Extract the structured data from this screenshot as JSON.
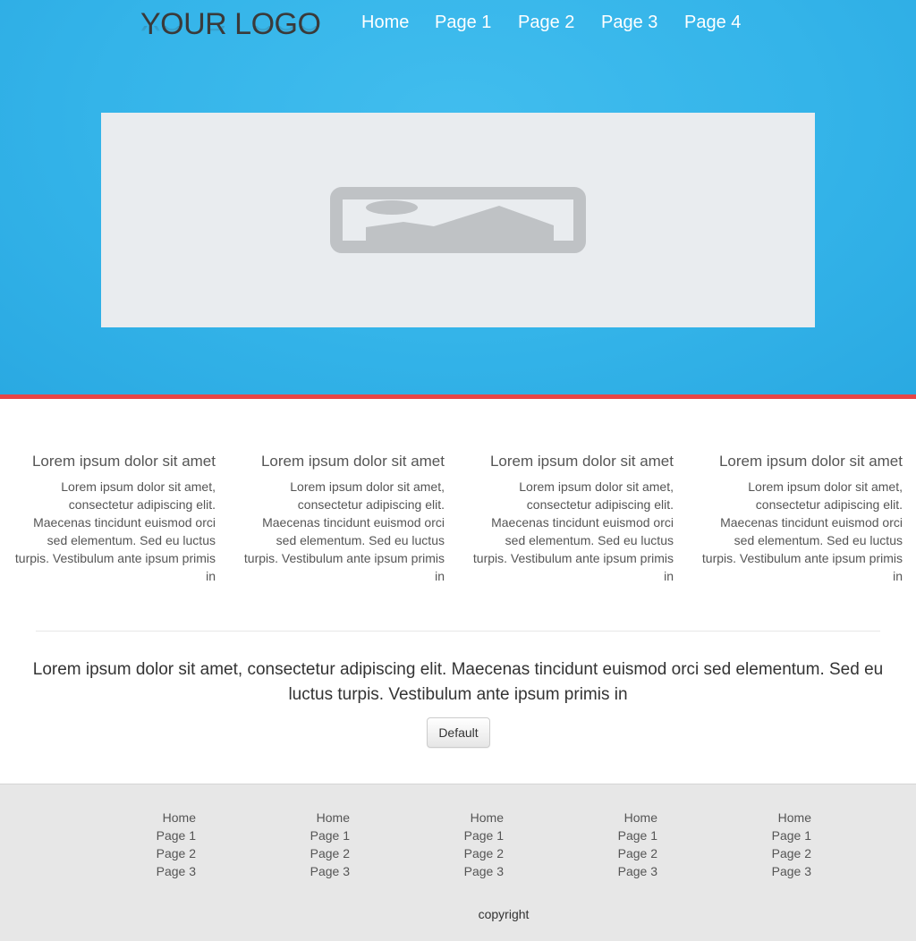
{
  "header": {
    "logo_text": "YOUR LOGO",
    "nav": [
      "Home",
      "Page 1",
      "Page 2",
      "Page 3",
      "Page 4"
    ]
  },
  "hero": {
    "image_icon": "image-placeholder-icon"
  },
  "features": [
    {
      "title": "Lorem ipsum dolor sit amet",
      "text": "Lorem ipsum dolor sit amet, consectetur adipiscing elit. Maecenas tincidunt euismod orci sed elementum. Sed eu luctus turpis. Vestibulum ante ipsum primis in"
    },
    {
      "title": "Lorem ipsum dolor sit amet",
      "text": "Lorem ipsum dolor sit amet, consectetur adipiscing elit. Maecenas tincidunt euismod orci sed elementum. Sed eu luctus turpis. Vestibulum ante ipsum primis in"
    },
    {
      "title": "Lorem ipsum dolor sit amet",
      "text": "Lorem ipsum dolor sit amet, consectetur adipiscing elit. Maecenas tincidunt euismod orci sed elementum. Sed eu luctus turpis. Vestibulum ante ipsum primis in"
    },
    {
      "title": "Lorem ipsum dolor sit amet",
      "text": "Lorem ipsum dolor sit amet, consectetur adipiscing elit. Maecenas tincidunt euismod orci sed elementum. Sed eu luctus turpis. Vestibulum ante ipsum primis in"
    }
  ],
  "lead": {
    "text": "Lorem ipsum dolor sit amet, consectetur adipiscing elit. Maecenas tincidunt euismod orci sed elementum. Sed eu luctus turpis. Vestibulum ante ipsum primis in",
    "button_label": "Default"
  },
  "footer": {
    "columns": [
      [
        "Home",
        "Page 1",
        "Page 2",
        "Page 3"
      ],
      [
        "Home",
        "Page 1",
        "Page 2",
        "Page 3"
      ],
      [
        "Home",
        "Page 1",
        "Page 2",
        "Page 3"
      ],
      [
        "Home",
        "Page 1",
        "Page 2",
        "Page 3"
      ],
      [
        "Home",
        "Page 1",
        "Page 2",
        "Page 3"
      ]
    ],
    "copyright": "copyright"
  },
  "colors": {
    "hero_blue": "#34b4e9",
    "accent_red": "#e84545",
    "footer_gray": "#e7e7e7"
  }
}
